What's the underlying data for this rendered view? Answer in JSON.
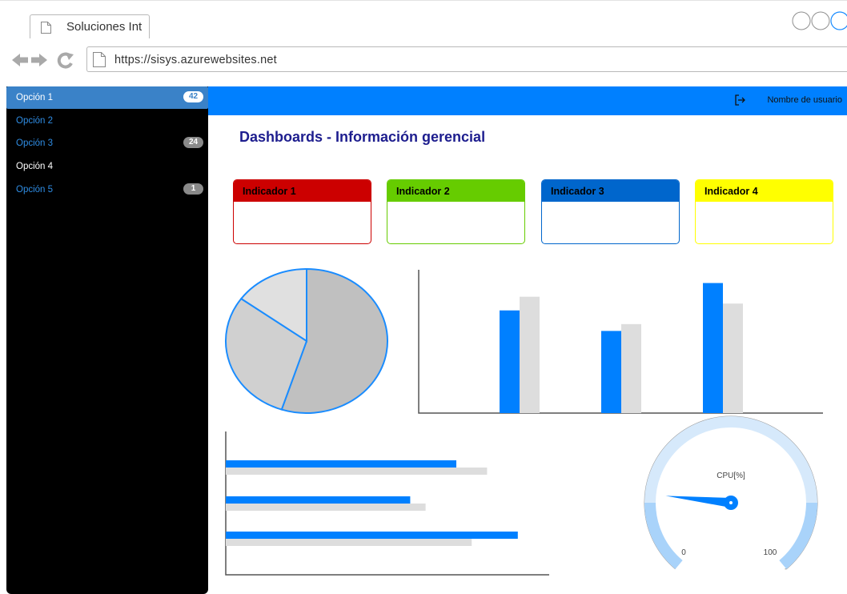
{
  "browser": {
    "tab_title": "Soluciones Int",
    "url": "https://sisys.azurewebsites.net"
  },
  "sidebar": {
    "items": [
      {
        "label": "Opción 1",
        "badge": "42",
        "active": true
      },
      {
        "label": "Opción 2",
        "badge": "",
        "active": false
      },
      {
        "label": "Opción 3",
        "badge": "24",
        "active": false
      },
      {
        "label": "Opción 4",
        "badge": "",
        "active": false
      },
      {
        "label": "Opción 5",
        "badge": "1",
        "active": false
      }
    ]
  },
  "header": {
    "user": "Nombre de usuario"
  },
  "page": {
    "title": "Dashboards - Información gerencial"
  },
  "indicators": [
    {
      "label": "Indicador 1",
      "color": "#cc0000"
    },
    {
      "label": "Indicador 2",
      "color": "#66cc00"
    },
    {
      "label": "Indicador 3",
      "color": "#0066cc"
    },
    {
      "label": "Indicador 4",
      "color": "#ffff00"
    }
  ],
  "colors": {
    "accent": "#0080ff",
    "series_secondary": "#dddddd",
    "page_title": "#1d1d8e"
  },
  "chart_data": [
    {
      "type": "pie",
      "values": [
        55,
        30,
        15
      ],
      "colors": [
        "#c0c0c0",
        "#d0d0d0",
        "#e0e0e0"
      ],
      "stroke": "#1a8cff"
    },
    {
      "type": "bar",
      "orientation": "vertical",
      "categories": [
        "",
        "",
        ""
      ],
      "series": [
        {
          "values": [
            75,
            60,
            95
          ],
          "color": "#0080ff"
        },
        {
          "values": [
            85,
            65,
            80
          ],
          "color": "#dddddd"
        }
      ],
      "ylim": [
        0,
        100
      ]
    },
    {
      "type": "bar",
      "orientation": "horizontal",
      "categories": [
        "",
        "",
        ""
      ],
      "series": [
        {
          "values": [
            75,
            60,
            95
          ],
          "color": "#0080ff"
        },
        {
          "values": [
            85,
            65,
            80
          ],
          "color": "#dddddd"
        }
      ],
      "xlim": [
        0,
        100
      ]
    },
    {
      "type": "gauge",
      "label": "CPU[%]",
      "min": 0,
      "max": 100,
      "min_label": "0",
      "max_label": "100",
      "value": 20
    }
  ]
}
